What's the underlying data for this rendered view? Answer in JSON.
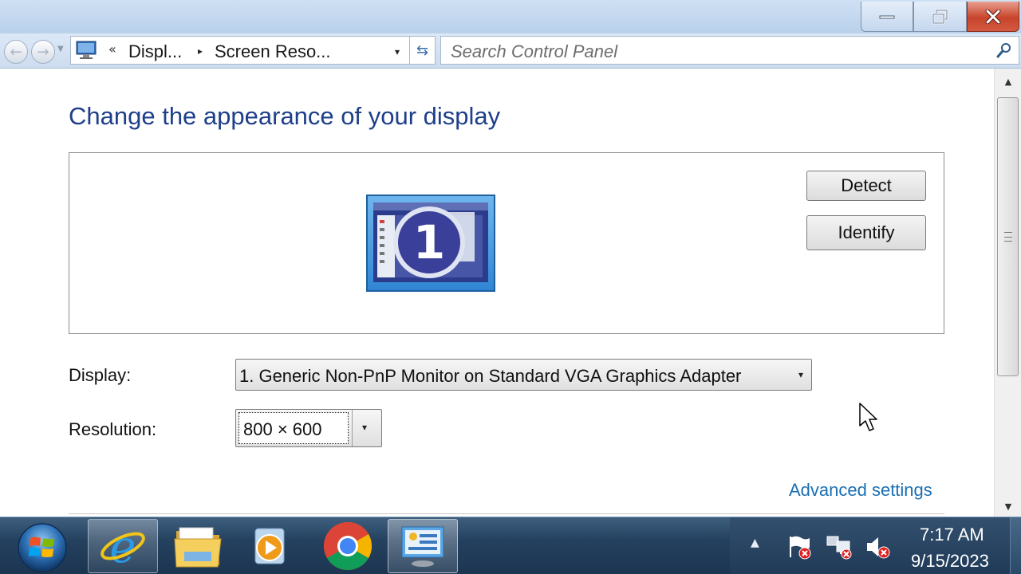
{
  "window": {
    "controls": {
      "minimize": "minimize",
      "maximize": "restore",
      "close": "close"
    }
  },
  "address_bar": {
    "overflow_chevron": "«",
    "crumbs": [
      "Displ...",
      "Screen Reso..."
    ],
    "separator": "▸",
    "dropdown_arrow": "▾",
    "refresh_glyph": "⇆"
  },
  "search": {
    "placeholder": "Search Control Panel",
    "icon": "search-icon"
  },
  "page": {
    "heading": "Change the appearance of your display",
    "monitor_number": "1",
    "detect_label": "Detect",
    "identify_label": "Identify",
    "display_label": "Display:",
    "display_value": "1. Generic Non-PnP Monitor on Standard VGA Graphics Adapter",
    "resolution_label": "Resolution:",
    "resolution_value": "800 × 600",
    "advanced_link": "Advanced settings",
    "select_arrow": "▾"
  },
  "taskbar": {
    "items": [
      "internet-explorer",
      "windows-explorer",
      "windows-media-player",
      "google-chrome",
      "control-panel-display"
    ],
    "tray_up": "▲",
    "clock_time": "7:17 AM",
    "clock_date": "9/15/2023"
  },
  "colors": {
    "heading": "#1e3f8a",
    "link": "#1a6fb3",
    "close_button": "#c8442b",
    "taskbar": "#24415f"
  }
}
